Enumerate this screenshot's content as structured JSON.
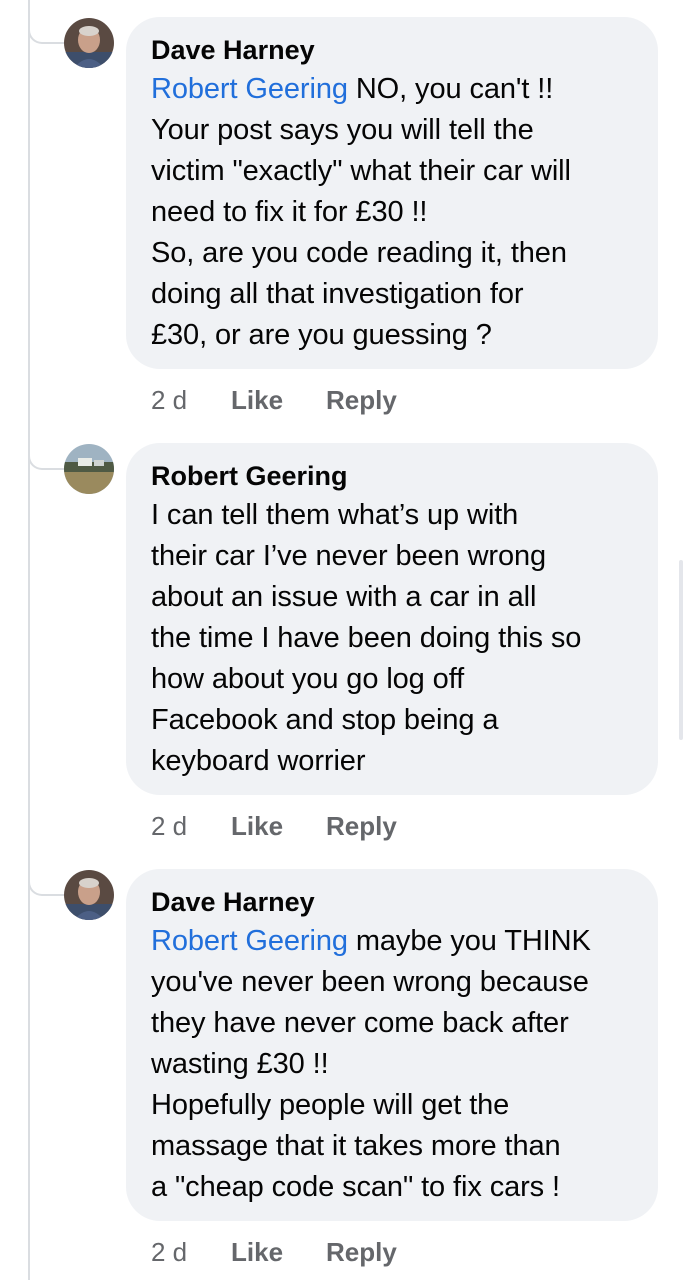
{
  "comments": [
    {
      "author": "Dave Harney",
      "mention": "Robert Geering",
      "text": " NO, you can't !!\nYour post says you will tell the\nvictim \"exactly\" what their car will\nneed to fix it for £30 !!\nSo, are you code reading it, then\ndoing all that investigation for\n£30, or are you guessing ?",
      "time": "2 d",
      "like_label": "Like",
      "reply_label": "Reply"
    },
    {
      "author": "Robert Geering",
      "mention": "",
      "text": "I can tell them what’s up with\ntheir car I’ve never been wrong\nabout an issue with a car in all\nthe time I have been doing this so\nhow about you go log off\nFacebook and stop being a\nkeyboard worrier",
      "time": "2 d",
      "like_label": "Like",
      "reply_label": "Reply"
    },
    {
      "author": "Dave Harney",
      "mention": "Robert Geering",
      "text": " maybe you THINK\nyou've never been wrong because\nthey have never come back after\nwasting £30 !!\nHopefully people will get the\nmassage that it takes more than\na \"cheap code scan\" to fix cars !",
      "time": "2 d",
      "like_label": "Like",
      "reply_label": "Reply"
    }
  ],
  "colors": {
    "bubble": "#f0f2f5",
    "mention": "#216fdb",
    "meta": "#65676b",
    "text": "#050505"
  }
}
